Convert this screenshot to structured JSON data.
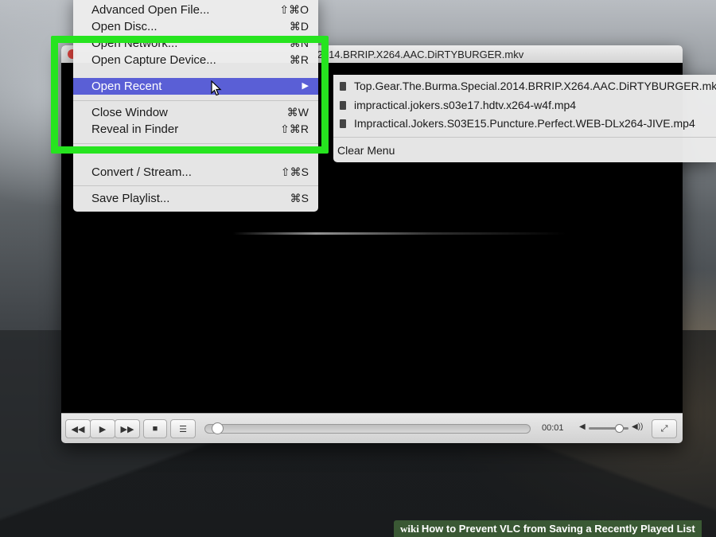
{
  "file_menu": {
    "items": [
      {
        "label": "Advanced Open File...",
        "shortcut": "⇧⌘O"
      },
      {
        "label": "Open Disc...",
        "shortcut": "⌘D"
      },
      {
        "label": "Open Network...",
        "shortcut": "⌘N"
      },
      {
        "label": "Open Capture Device...",
        "shortcut": "⌘R"
      },
      {
        "label": "Open Recent",
        "arrow": "▶"
      },
      {
        "label": "Close Window",
        "shortcut": "⌘W"
      },
      {
        "label": "Reveal in Finder",
        "shortcut": "⇧⌘R"
      },
      {
        "label": "Convert / Stream...",
        "shortcut": "⇧⌘S"
      },
      {
        "label": "Save Playlist...",
        "shortcut": "⌘S"
      }
    ]
  },
  "recent_menu": {
    "items": [
      "Top.Gear.The.Burma.Special.2014.BRRIP.X264.AAC.DiRTYBURGER.mkv",
      "impractical.jokers.s03e17.hdtv.x264-w4f.mp4",
      "Impractical.Jokers.S03E15.Puncture.Perfect.WEB-DLx264-JIVE.mp4"
    ],
    "clear_label": "Clear Menu"
  },
  "window": {
    "title": ".2014.BRRIP.X264.AAC.DiRTYBURGER.mkv"
  },
  "controls": {
    "rewind": "◀◀",
    "play": "▶",
    "forward": "▶▶",
    "stop": "■",
    "playlist": "☰",
    "time": "00:01",
    "progress": 0.02,
    "volume": 0.8,
    "volume_low": "◀",
    "volume_high": "◀))",
    "fullscreen": "⤢"
  },
  "watermark": {
    "brand": "wiki",
    "text": "How to Prevent VLC from Saving a Recently Played List"
  },
  "colors": {
    "highlight_box": "#26e41f",
    "menu_selection": "#5a5fd6"
  }
}
